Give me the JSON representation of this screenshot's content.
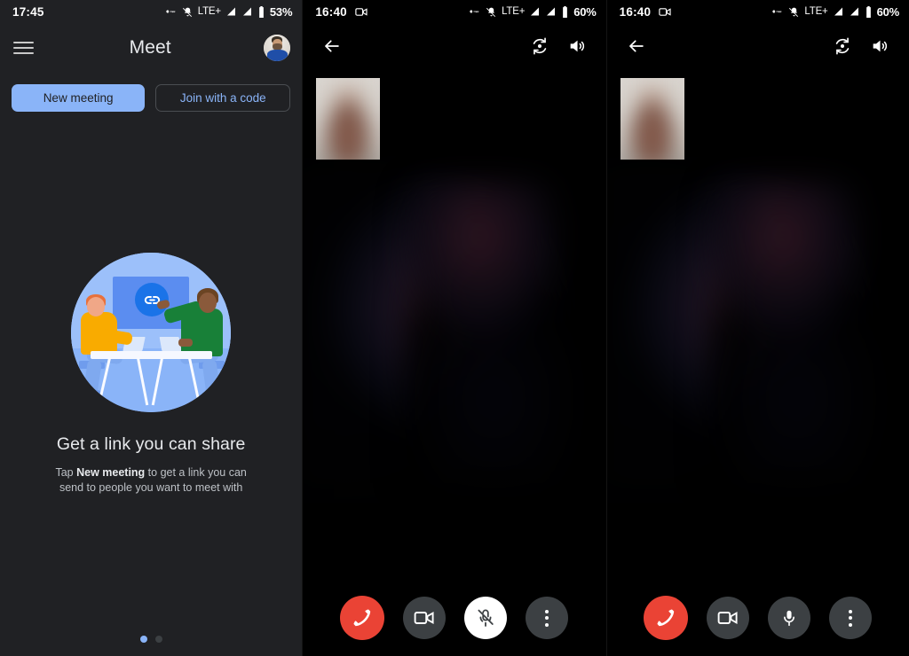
{
  "panels": {
    "home": {
      "status": {
        "time": "17:45",
        "network": "LTE+",
        "battery": "53%",
        "icons": [
          "vpn-key-icon",
          "vibrate-off-icon",
          "signal-bars-icon",
          "signal-bars-icon",
          "battery-icon"
        ]
      },
      "appbar": {
        "menu_icon": "hamburger-menu-icon",
        "title": "Meet",
        "avatar": "user-avatar"
      },
      "buttons": {
        "new_meeting": "New meeting",
        "join_code": "Join with a code"
      },
      "empty_state": {
        "illustration": "two-people-meeting-link-illustration",
        "link_icon": "link-icon",
        "title": "Get a link you can share",
        "body_prefix": "Tap ",
        "body_bold": "New meeting",
        "body_suffix": " to get a link you can send to people you want to meet with"
      },
      "pager": {
        "total": 2,
        "active": 1
      }
    },
    "call_muted": {
      "status": {
        "time": "16:40",
        "call_icon": "video-call-active-icon",
        "network": "LTE+",
        "battery": "60%"
      },
      "toolbar": {
        "back": "back-arrow-icon",
        "switch_camera": "switch-camera-icon",
        "speaker": "speaker-volume-icon"
      },
      "selfview": "self-view-thumbnail",
      "controls": [
        {
          "name": "end-call-button",
          "icon": "call-end-icon",
          "style": "hang"
        },
        {
          "name": "camera-toggle-button",
          "icon": "videocam-icon",
          "style": "dark"
        },
        {
          "name": "microphone-toggle-button",
          "icon": "mic-off-icon",
          "style": "white"
        },
        {
          "name": "more-options-button",
          "icon": "more-vert-icon",
          "style": "dark"
        }
      ]
    },
    "call_unmuted": {
      "status": {
        "time": "16:40",
        "call_icon": "video-call-active-icon",
        "network": "LTE+",
        "battery": "60%"
      },
      "toolbar": {
        "back": "back-arrow-icon",
        "switch_camera": "switch-camera-icon",
        "speaker": "speaker-volume-icon"
      },
      "selfview": "self-view-thumbnail",
      "controls": [
        {
          "name": "end-call-button",
          "icon": "call-end-icon",
          "style": "hang"
        },
        {
          "name": "camera-toggle-button",
          "icon": "videocam-icon",
          "style": "dark"
        },
        {
          "name": "microphone-toggle-button",
          "icon": "mic-icon",
          "style": "dark"
        },
        {
          "name": "more-options-button",
          "icon": "more-vert-icon",
          "style": "dark"
        }
      ]
    }
  },
  "colors": {
    "accent": "#8ab4f8",
    "surface": "#202124",
    "danger": "#ea4335",
    "control": "#3c4043",
    "on_surface": "#e8eaed",
    "secondary_text": "#bdc1c6"
  }
}
